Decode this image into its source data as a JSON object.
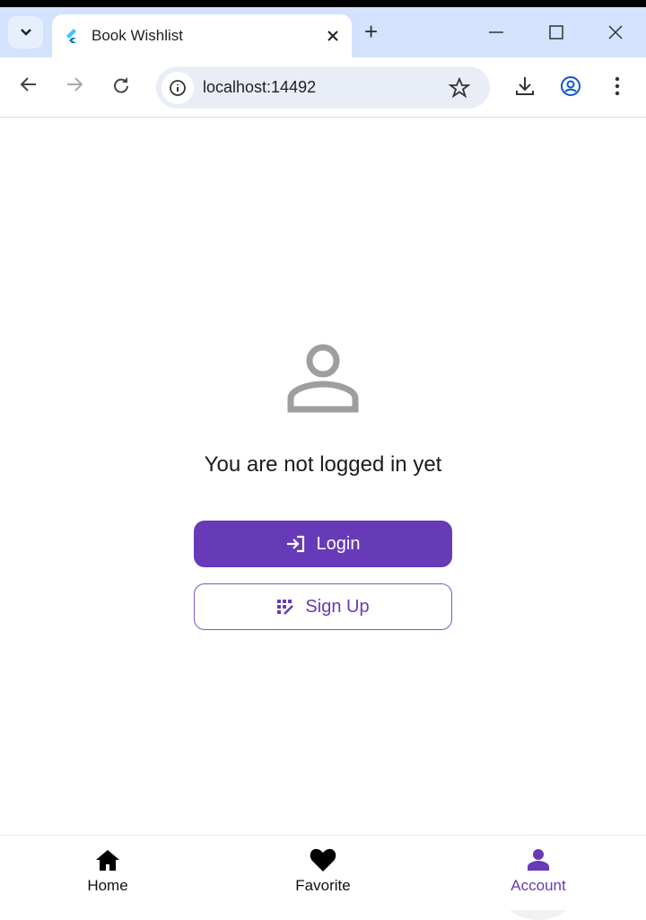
{
  "browser": {
    "tab_title": "Book Wishlist",
    "url": "localhost:14492"
  },
  "main": {
    "message": "You are not logged in yet",
    "login_label": "Login",
    "signup_label": "Sign Up"
  },
  "nav": {
    "items": [
      {
        "label": "Home"
      },
      {
        "label": "Favorite"
      },
      {
        "label": "Account"
      }
    ]
  },
  "colors": {
    "accent": "#673ab7",
    "tabstrip": "#d3e3fd"
  }
}
